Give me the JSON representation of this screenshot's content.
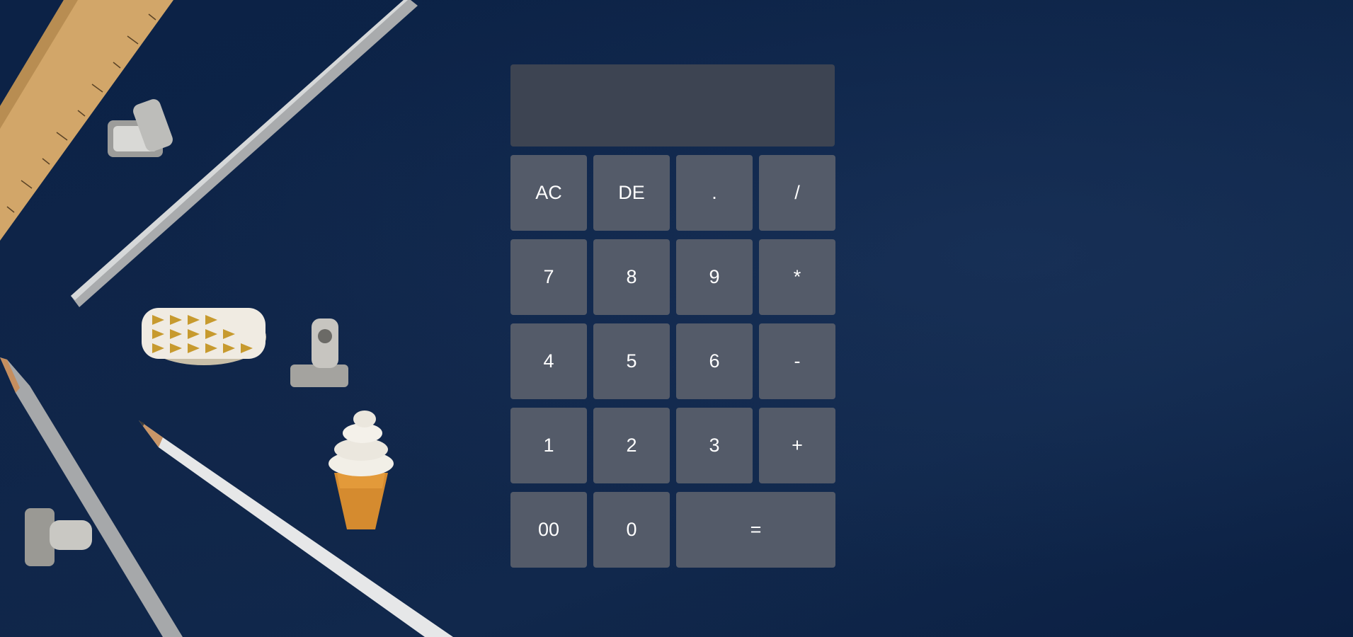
{
  "display": {
    "value": ""
  },
  "keys": {
    "ac": "AC",
    "de": "DE",
    "dot": ".",
    "divide": "/",
    "seven": "7",
    "eight": "8",
    "nine": "9",
    "multiply": "*",
    "four": "4",
    "five": "5",
    "six": "6",
    "minus": "-",
    "one": "1",
    "two": "2",
    "three": "3",
    "plus": "+",
    "double_zero": "00",
    "zero": "0",
    "equals": "="
  },
  "colors": {
    "background": "#0d2448",
    "display": "#3d4452",
    "key": "#545b69",
    "text": "#ffffff"
  }
}
